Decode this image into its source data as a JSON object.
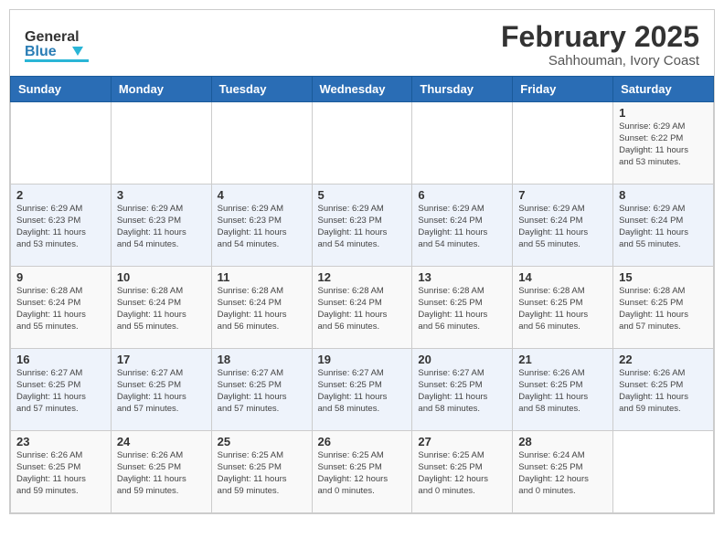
{
  "header": {
    "logo_general": "General",
    "logo_blue": "Blue",
    "month_title": "February 2025",
    "location": "Sahhouman, Ivory Coast"
  },
  "weekdays": [
    "Sunday",
    "Monday",
    "Tuesday",
    "Wednesday",
    "Thursday",
    "Friday",
    "Saturday"
  ],
  "weeks": [
    [
      {
        "day": "",
        "info": ""
      },
      {
        "day": "",
        "info": ""
      },
      {
        "day": "",
        "info": ""
      },
      {
        "day": "",
        "info": ""
      },
      {
        "day": "",
        "info": ""
      },
      {
        "day": "",
        "info": ""
      },
      {
        "day": "1",
        "info": "Sunrise: 6:29 AM\nSunset: 6:22 PM\nDaylight: 11 hours\nand 53 minutes."
      }
    ],
    [
      {
        "day": "2",
        "info": "Sunrise: 6:29 AM\nSunset: 6:23 PM\nDaylight: 11 hours\nand 53 minutes."
      },
      {
        "day": "3",
        "info": "Sunrise: 6:29 AM\nSunset: 6:23 PM\nDaylight: 11 hours\nand 54 minutes."
      },
      {
        "day": "4",
        "info": "Sunrise: 6:29 AM\nSunset: 6:23 PM\nDaylight: 11 hours\nand 54 minutes."
      },
      {
        "day": "5",
        "info": "Sunrise: 6:29 AM\nSunset: 6:23 PM\nDaylight: 11 hours\nand 54 minutes."
      },
      {
        "day": "6",
        "info": "Sunrise: 6:29 AM\nSunset: 6:24 PM\nDaylight: 11 hours\nand 54 minutes."
      },
      {
        "day": "7",
        "info": "Sunrise: 6:29 AM\nSunset: 6:24 PM\nDaylight: 11 hours\nand 55 minutes."
      },
      {
        "day": "8",
        "info": "Sunrise: 6:29 AM\nSunset: 6:24 PM\nDaylight: 11 hours\nand 55 minutes."
      }
    ],
    [
      {
        "day": "9",
        "info": "Sunrise: 6:28 AM\nSunset: 6:24 PM\nDaylight: 11 hours\nand 55 minutes."
      },
      {
        "day": "10",
        "info": "Sunrise: 6:28 AM\nSunset: 6:24 PM\nDaylight: 11 hours\nand 55 minutes."
      },
      {
        "day": "11",
        "info": "Sunrise: 6:28 AM\nSunset: 6:24 PM\nDaylight: 11 hours\nand 56 minutes."
      },
      {
        "day": "12",
        "info": "Sunrise: 6:28 AM\nSunset: 6:24 PM\nDaylight: 11 hours\nand 56 minutes."
      },
      {
        "day": "13",
        "info": "Sunrise: 6:28 AM\nSunset: 6:25 PM\nDaylight: 11 hours\nand 56 minutes."
      },
      {
        "day": "14",
        "info": "Sunrise: 6:28 AM\nSunset: 6:25 PM\nDaylight: 11 hours\nand 56 minutes."
      },
      {
        "day": "15",
        "info": "Sunrise: 6:28 AM\nSunset: 6:25 PM\nDaylight: 11 hours\nand 57 minutes."
      }
    ],
    [
      {
        "day": "16",
        "info": "Sunrise: 6:27 AM\nSunset: 6:25 PM\nDaylight: 11 hours\nand 57 minutes."
      },
      {
        "day": "17",
        "info": "Sunrise: 6:27 AM\nSunset: 6:25 PM\nDaylight: 11 hours\nand 57 minutes."
      },
      {
        "day": "18",
        "info": "Sunrise: 6:27 AM\nSunset: 6:25 PM\nDaylight: 11 hours\nand 57 minutes."
      },
      {
        "day": "19",
        "info": "Sunrise: 6:27 AM\nSunset: 6:25 PM\nDaylight: 11 hours\nand 58 minutes."
      },
      {
        "day": "20",
        "info": "Sunrise: 6:27 AM\nSunset: 6:25 PM\nDaylight: 11 hours\nand 58 minutes."
      },
      {
        "day": "21",
        "info": "Sunrise: 6:26 AM\nSunset: 6:25 PM\nDaylight: 11 hours\nand 58 minutes."
      },
      {
        "day": "22",
        "info": "Sunrise: 6:26 AM\nSunset: 6:25 PM\nDaylight: 11 hours\nand 59 minutes."
      }
    ],
    [
      {
        "day": "23",
        "info": "Sunrise: 6:26 AM\nSunset: 6:25 PM\nDaylight: 11 hours\nand 59 minutes."
      },
      {
        "day": "24",
        "info": "Sunrise: 6:26 AM\nSunset: 6:25 PM\nDaylight: 11 hours\nand 59 minutes."
      },
      {
        "day": "25",
        "info": "Sunrise: 6:25 AM\nSunset: 6:25 PM\nDaylight: 11 hours\nand 59 minutes."
      },
      {
        "day": "26",
        "info": "Sunrise: 6:25 AM\nSunset: 6:25 PM\nDaylight: 12 hours\nand 0 minutes."
      },
      {
        "day": "27",
        "info": "Sunrise: 6:25 AM\nSunset: 6:25 PM\nDaylight: 12 hours\nand 0 minutes."
      },
      {
        "day": "28",
        "info": "Sunrise: 6:24 AM\nSunset: 6:25 PM\nDaylight: 12 hours\nand 0 minutes."
      },
      {
        "day": "",
        "info": ""
      }
    ]
  ]
}
